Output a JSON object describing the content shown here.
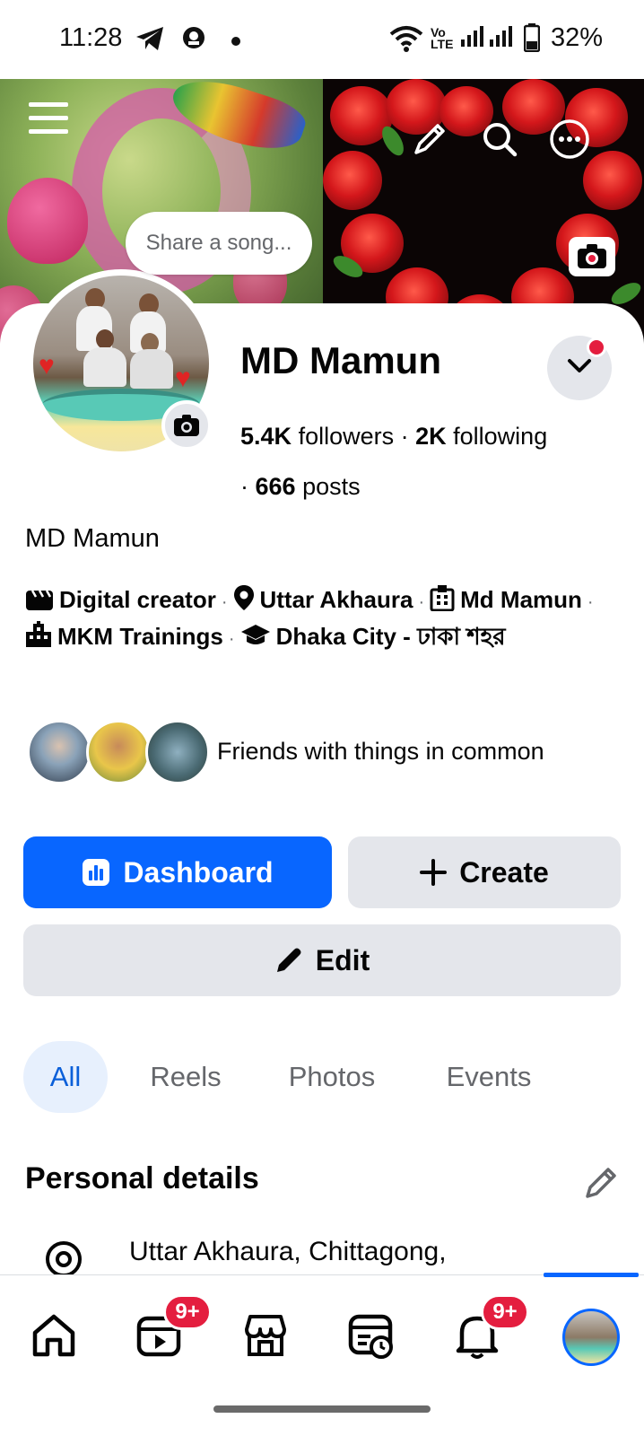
{
  "status_bar": {
    "time": "11:28",
    "battery": "32%",
    "icons": [
      "telegram-icon",
      "app-icon",
      "dot-icon",
      "wifi-icon",
      "volte-icon",
      "signal-icon",
      "signal-icon",
      "battery-icon"
    ]
  },
  "cover": {
    "share_song_label": "Share a song..."
  },
  "profile": {
    "name": "MD Mamun",
    "followers_count": "5.4K",
    "followers_label": "followers",
    "following_count": "2K",
    "following_label": "following",
    "posts_count": "666",
    "posts_label": "posts",
    "bio_name": "MD Mamun",
    "details": {
      "category": "Digital creator",
      "location": "Uttar Akhaura",
      "work1": "Md Mamun",
      "work2": "MKM Trainings",
      "education": "Dhaka City - ঢাকা শহর"
    },
    "friends_text": "Friends with things in common"
  },
  "actions": {
    "dashboard_label": "Dashboard",
    "create_label": "Create",
    "edit_label": "Edit"
  },
  "tabs": [
    {
      "label": "All",
      "active": true
    },
    {
      "label": "Reels",
      "active": false
    },
    {
      "label": "Photos",
      "active": false
    },
    {
      "label": "Events",
      "active": false
    }
  ],
  "personal_details": {
    "title": "Personal details",
    "location": "Uttar Akhaura, Chittagong,"
  },
  "bottom_nav": {
    "video_badge": "9+",
    "notifications_badge": "9+"
  },
  "colors": {
    "accent": "#0866ff",
    "badge": "#e41e3f",
    "secondary_button": "#e4e6eb"
  }
}
